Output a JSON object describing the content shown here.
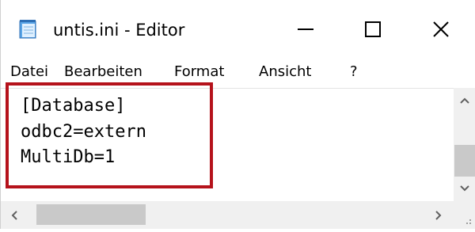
{
  "window": {
    "title": "untis.ini - Editor",
    "icon": "notepad-icon"
  },
  "menu": {
    "items": [
      "Datei",
      "Bearbeiten",
      "Format",
      "Ansicht",
      "?"
    ]
  },
  "editor": {
    "lines": [
      "[Database]",
      "odbc2=extern",
      "MultiDb=1"
    ]
  },
  "colors": {
    "highlight_border": "#b5121b",
    "scrollbar_bg": "#f0f0f0",
    "scrollbar_thumb": "#c9c9c9"
  }
}
